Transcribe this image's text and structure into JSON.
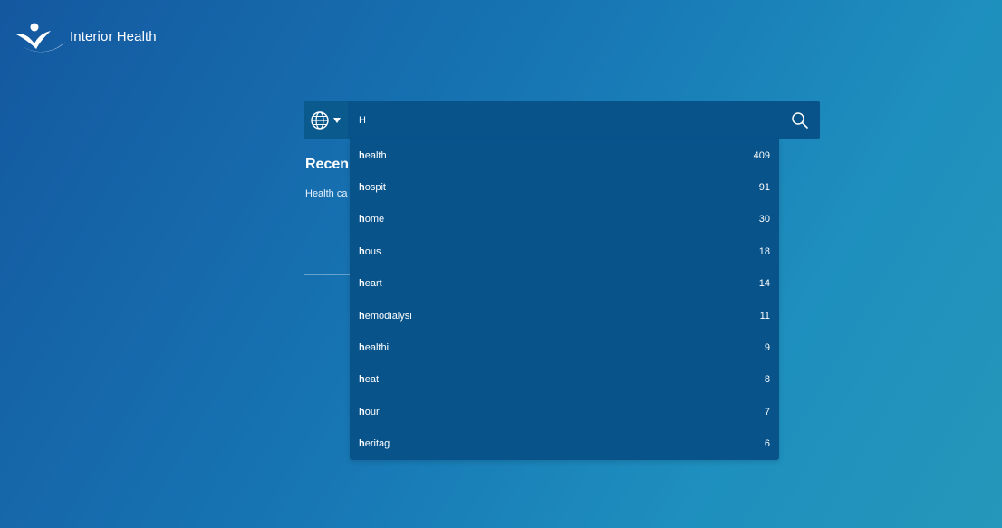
{
  "brand": {
    "name": "Interior Health",
    "logo_icon": "interior-health-logo"
  },
  "search": {
    "language_icon": "globe-icon",
    "value": "H",
    "search_icon": "search-icon"
  },
  "recent": {
    "heading": "Recen",
    "items": [
      "Health ca"
    ]
  },
  "suggestions": [
    {
      "prefix": "h",
      "rest": "ealth",
      "count": "409"
    },
    {
      "prefix": "h",
      "rest": "ospit",
      "count": "91"
    },
    {
      "prefix": "h",
      "rest": "ome",
      "count": "30"
    },
    {
      "prefix": "h",
      "rest": "ous",
      "count": "18"
    },
    {
      "prefix": "h",
      "rest": "eart",
      "count": "14"
    },
    {
      "prefix": "h",
      "rest": "emodialysi",
      "count": "11"
    },
    {
      "prefix": "h",
      "rest": "ealthi",
      "count": "9"
    },
    {
      "prefix": "h",
      "rest": "eat",
      "count": "8"
    },
    {
      "prefix": "h",
      "rest": "our",
      "count": "7"
    },
    {
      "prefix": "h",
      "rest": "eritag",
      "count": "6"
    }
  ],
  "colors": {
    "background_start": "#1458a0",
    "background_end": "#2597ba",
    "search_bg": "#07538a",
    "text": "#ffffff"
  }
}
